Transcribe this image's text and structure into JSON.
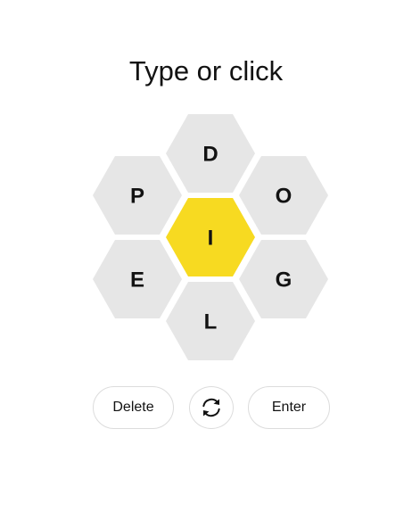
{
  "prompt": "Type or click",
  "colors": {
    "center": "#f7da21",
    "outer": "#e6e6e6",
    "text": "#121212",
    "button_border": "#dcdcdc"
  },
  "hive": {
    "center_letter": "I",
    "outer_letters": [
      "D",
      "O",
      "G",
      "L",
      "E",
      "P"
    ]
  },
  "buttons": {
    "delete": "Delete",
    "shuffle_icon": "shuffle-icon",
    "enter": "Enter"
  }
}
